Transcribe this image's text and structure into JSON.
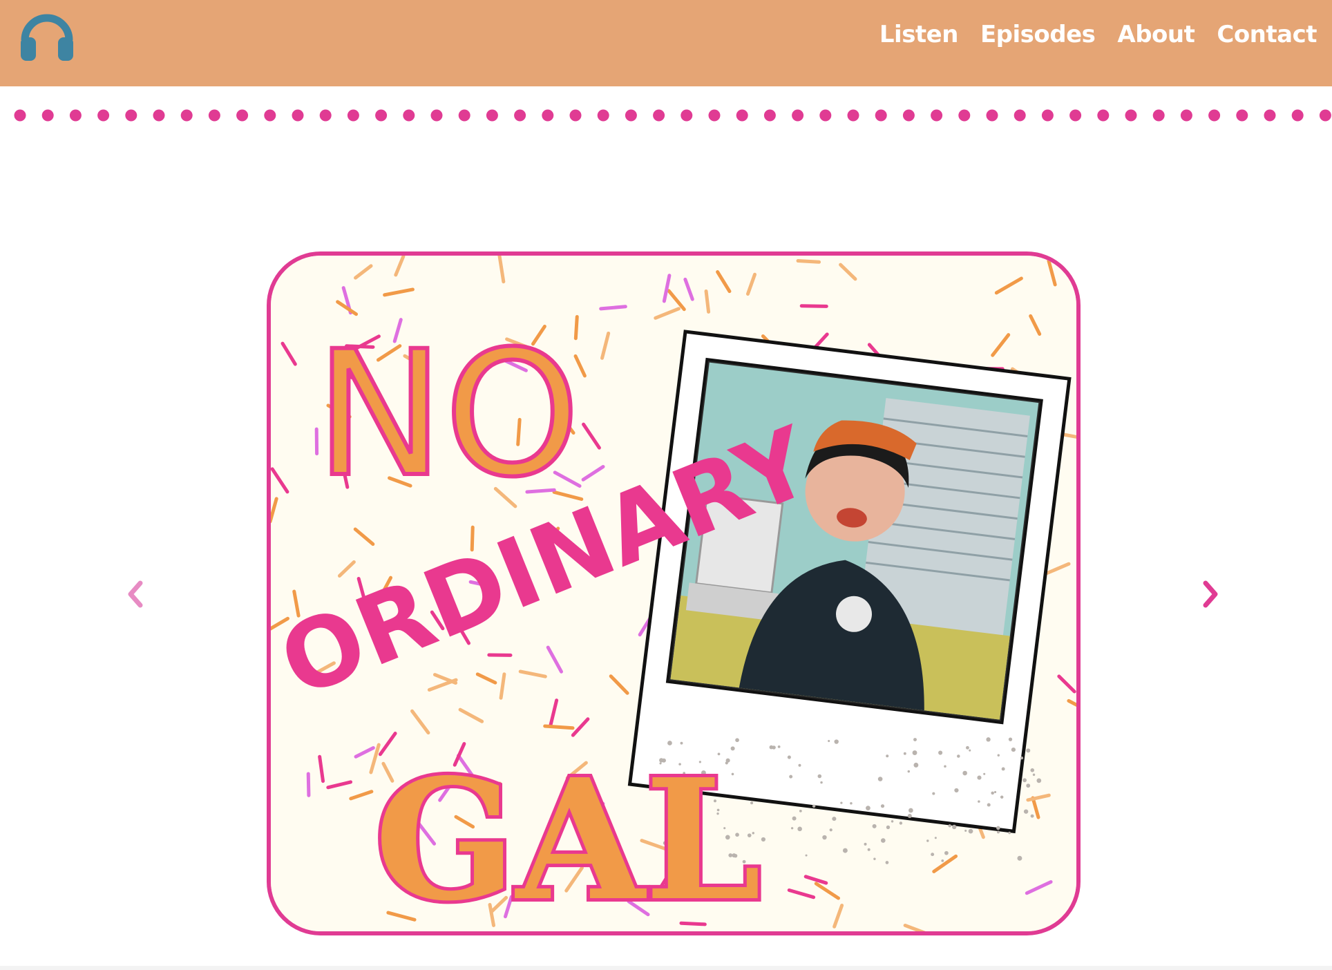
{
  "header": {
    "logo_icon": "headphones-icon",
    "background_color": "#E5A575",
    "logo_color": "#3E84A2"
  },
  "nav": {
    "items": [
      {
        "label": "Listen"
      },
      {
        "label": "Episodes"
      },
      {
        "label": "About"
      },
      {
        "label": "Contact"
      }
    ]
  },
  "divider": {
    "style": "pink-dotted",
    "color": "#E03B93"
  },
  "slider": {
    "prev_icon": "chevron-left-icon",
    "next_icon": "chevron-right-icon",
    "prev_color": "#E78BC3",
    "next_color": "#E03B93"
  },
  "cover_art": {
    "title_line1": "NO",
    "title_line2": "ORDINARY",
    "title_line3": "GAL",
    "border_color": "#E03B93",
    "accent_orange": "#F19A48",
    "accent_pink": "#E9398F",
    "accent_purple": "#DE6FE0"
  }
}
